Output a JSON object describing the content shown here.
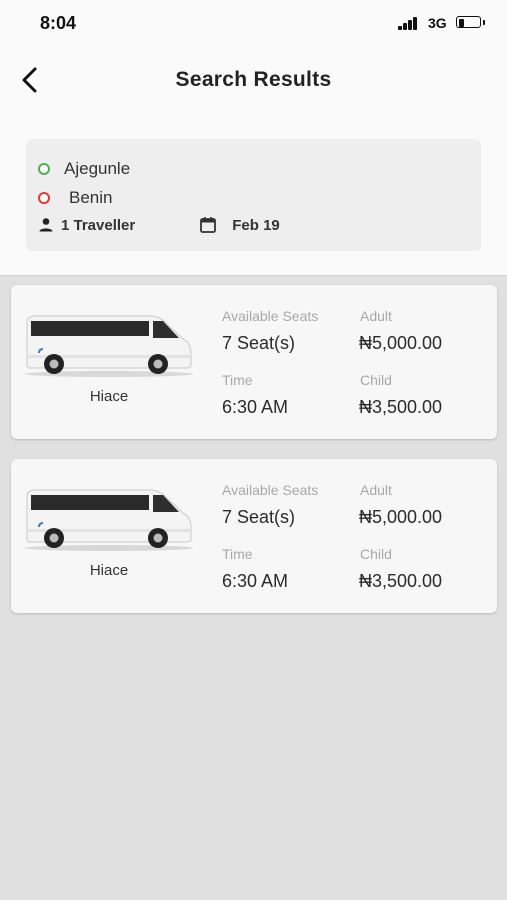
{
  "status_bar": {
    "time": "8:04",
    "network": "3G"
  },
  "header": {
    "title": "Search Results"
  },
  "trip": {
    "origin": "Ajegunle",
    "destination": "Benin",
    "travellers": "1 Traveller",
    "date": "Feb 19"
  },
  "results": [
    {
      "vehicle": "Hiace",
      "seats_label": "Available Seats",
      "seats": "7 Seat(s)",
      "time_label": "Time",
      "time": "6:30 AM",
      "adult_label": "Adult",
      "adult_price": "₦5,000.00",
      "child_label": "Child",
      "child_price": "₦3,500.00"
    },
    {
      "vehicle": "Hiace",
      "seats_label": "Available Seats",
      "seats": "7 Seat(s)",
      "time_label": "Time",
      "time": "6:30 AM",
      "adult_label": "Adult",
      "adult_price": "₦5,000.00",
      "child_label": "Child",
      "child_price": "₦3,500.00"
    }
  ],
  "colors": {
    "origin_dot": "#4caf50",
    "destination_dot": "#e53935",
    "page_background": "#e0e0e0"
  }
}
